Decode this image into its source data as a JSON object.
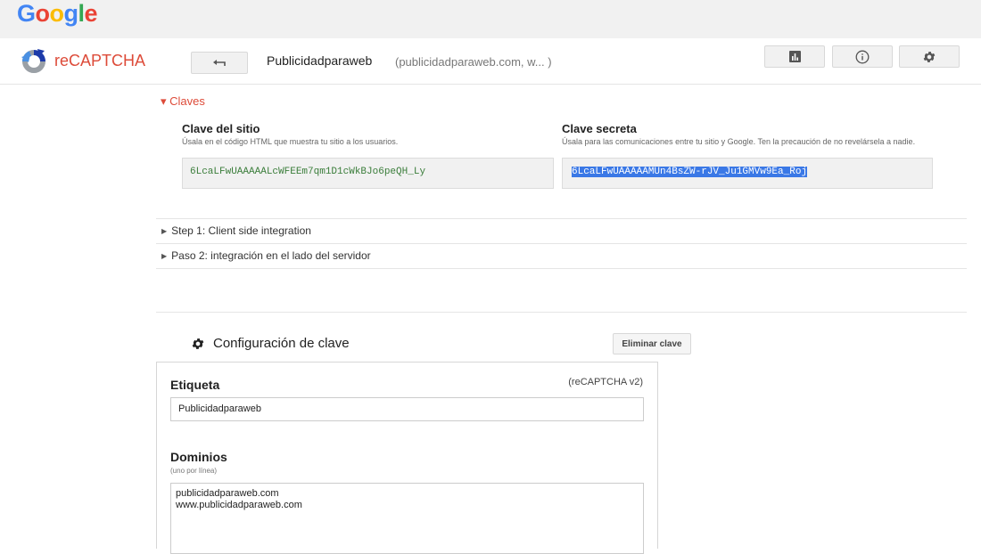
{
  "google_bar": {
    "logo_letters": [
      "G",
      "o",
      "o",
      "g",
      "l",
      "e"
    ],
    "logo_colors": [
      "#4285f4",
      "#ea4335",
      "#fbbc05",
      "#4285f4",
      "#34a853",
      "#ea4335"
    ]
  },
  "header": {
    "app_title": "reCAPTCHA",
    "back_icon": "back-arrow-icon",
    "site_name": "Publicidadparaweb",
    "site_domains": "(publicidadparaweb.com, w... )",
    "action_icons": [
      "analytics-icon",
      "info-icon",
      "settings-gear-icon"
    ],
    "accent_color": "#dd4b39"
  },
  "claves": {
    "toggle_label": "▾ Claves",
    "site_key": {
      "label": "Clave del sitio",
      "help": "Úsala en el código HTML que muestra tu sitio a los usuarios.",
      "value": "6LcaLFwUAAAAALcWFEEm7qm1D1cWkBJo6peQH_Ly"
    },
    "secret_key": {
      "label": "Clave secreta",
      "help": "Úsala para las comunicaciones entre tu sitio y Google. Ten la precaución de no revelársela a nadie.",
      "value": "6LcaLFwUAAAAAMUn4BsZW-rJV_Ju1GMVw9Ea_Roj"
    }
  },
  "steps": [
    {
      "label": "Step 1: Client side integration"
    },
    {
      "label": "Paso 2: integración en el lado del servidor"
    }
  ],
  "config": {
    "title": "Configuración de clave",
    "delete_button": "Eliminar clave",
    "label_field": {
      "label": "Etiqueta",
      "version": "(reCAPTCHA v2)",
      "value": "Publicidadparaweb"
    },
    "domains_field": {
      "label": "Dominios",
      "help": "(uno por línea)",
      "lines": [
        "publicidadparaweb.com",
        "www.publicidadparaweb.com"
      ]
    }
  }
}
